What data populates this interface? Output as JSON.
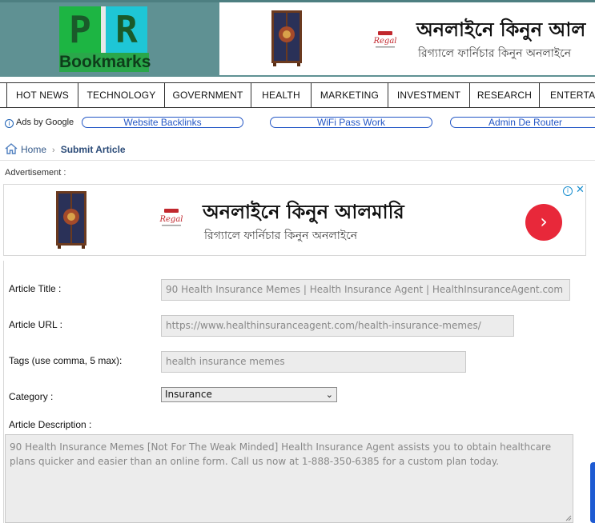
{
  "site": {
    "logo": {
      "letters": [
        "P",
        "R"
      ],
      "wordmark": "Bookmarks"
    }
  },
  "header_ad": {
    "title": "অনলাইনে কিনুন আল",
    "subtitle": "রিগ্যালে ফার্নিচার কিনুন অনলাইনে",
    "brand": "Regal"
  },
  "nav": {
    "items": [
      "HOT NEWS",
      "TECHNOLOGY",
      "GOVERNMENT",
      "HEALTH",
      "MARKETING",
      "INVESTMENT",
      "RESEARCH",
      "ENTERTAIN"
    ]
  },
  "ads_row": {
    "ads_by": "Ads by Google",
    "links": [
      "Website Backlinks",
      "WiFi Pass Work",
      "Admin De Router"
    ]
  },
  "breadcrumb": {
    "home": "Home",
    "current": "Submit Article"
  },
  "advertisement_label": "Advertisement :",
  "big_ad": {
    "title": "অনলাইনে কিনুন আলমারি",
    "subtitle": "রিগ্যালে ফার্নিচার কিনুন অনলাইনে",
    "brand": "Regal",
    "arrow": "›",
    "info": "i",
    "close": "✕"
  },
  "form": {
    "title_label": "Article Title :",
    "title_value": "90 Health Insurance Memes | Health Insurance Agent | HealthInsuranceAgent.com",
    "url_label": "Article URL :",
    "url_value": "https://www.healthinsuranceagent.com/health-insurance-memes/",
    "tags_label": "Tags (use comma, 5 max):",
    "tags_value": "health insurance memes",
    "category_label": "Category :",
    "category_value": "Insurance",
    "description_label": "Article Description :",
    "description_value": "90 Health Insurance Memes [Not For The Weak Minded] Health Insurance Agent assists you to obtain healthcare plans quicker and easier than an online form. Call us now at 1-888-350-6385 for a custom plan today."
  },
  "colors": {
    "header_bg": "#5f9193",
    "link_blue": "#2457c5",
    "ad_button": "#e8283a"
  }
}
